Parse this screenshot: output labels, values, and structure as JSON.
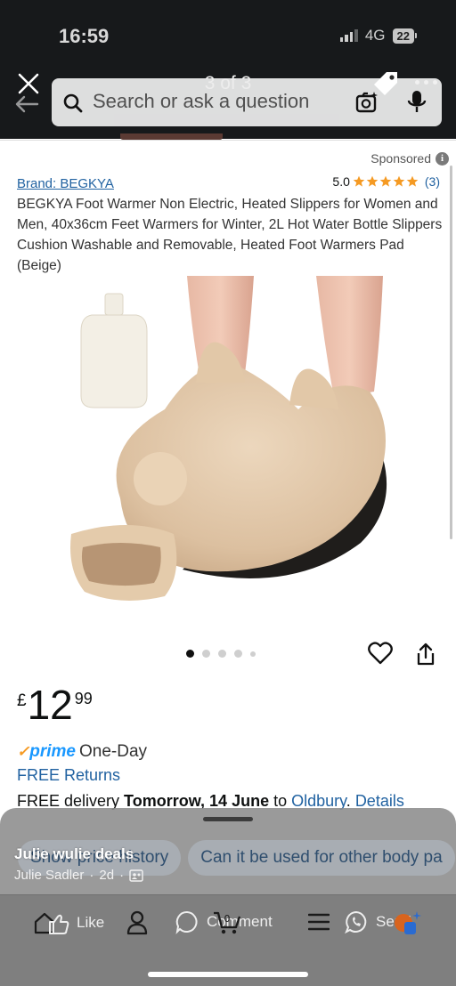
{
  "status_bar": {
    "time": "16:59",
    "network": "4G",
    "battery": "22"
  },
  "viewer": {
    "counter": "3 of 3"
  },
  "search": {
    "placeholder": "Search or ask a question"
  },
  "product": {
    "sponsored_label": "Sponsored",
    "brand": "Brand: BEGKYA",
    "rating_value": "5.0",
    "rating_count": "(3)",
    "stars": 5,
    "title": "BEGKYA Foot Warmer Non Electric, Heated Slippers for Women and Men, 40x36cm Feet Warmers for Winter, 2L Hot Water Bottle Slippers Cushion Washable and Removable, Heated Foot Warmers Pad (Beige)",
    "image_count": 5,
    "active_image": 1,
    "price": {
      "symbol": "£",
      "whole": "12",
      "fraction": "99"
    },
    "prime_text": "One-Day",
    "prime_logo": "prime",
    "returns": "FREE Returns",
    "delivery": {
      "prefix": "FREE delivery ",
      "date": "Tomorrow, 14 June",
      "to": " to ",
      "location": "Oldbury",
      "sep": ". ",
      "details": "Details"
    }
  },
  "overlay": {
    "chips": [
      "Show price history",
      "Can it be used for other body pa"
    ],
    "poster": "Julie wulie deals",
    "author": "Julie Sadler",
    "time": "2d",
    "dot": "·"
  },
  "actions": {
    "like": "Like",
    "comment": "Comment",
    "send": "Send"
  },
  "colors": {
    "link": "#2162a1",
    "star": "#f59a23",
    "prime": "#1a98ff"
  }
}
